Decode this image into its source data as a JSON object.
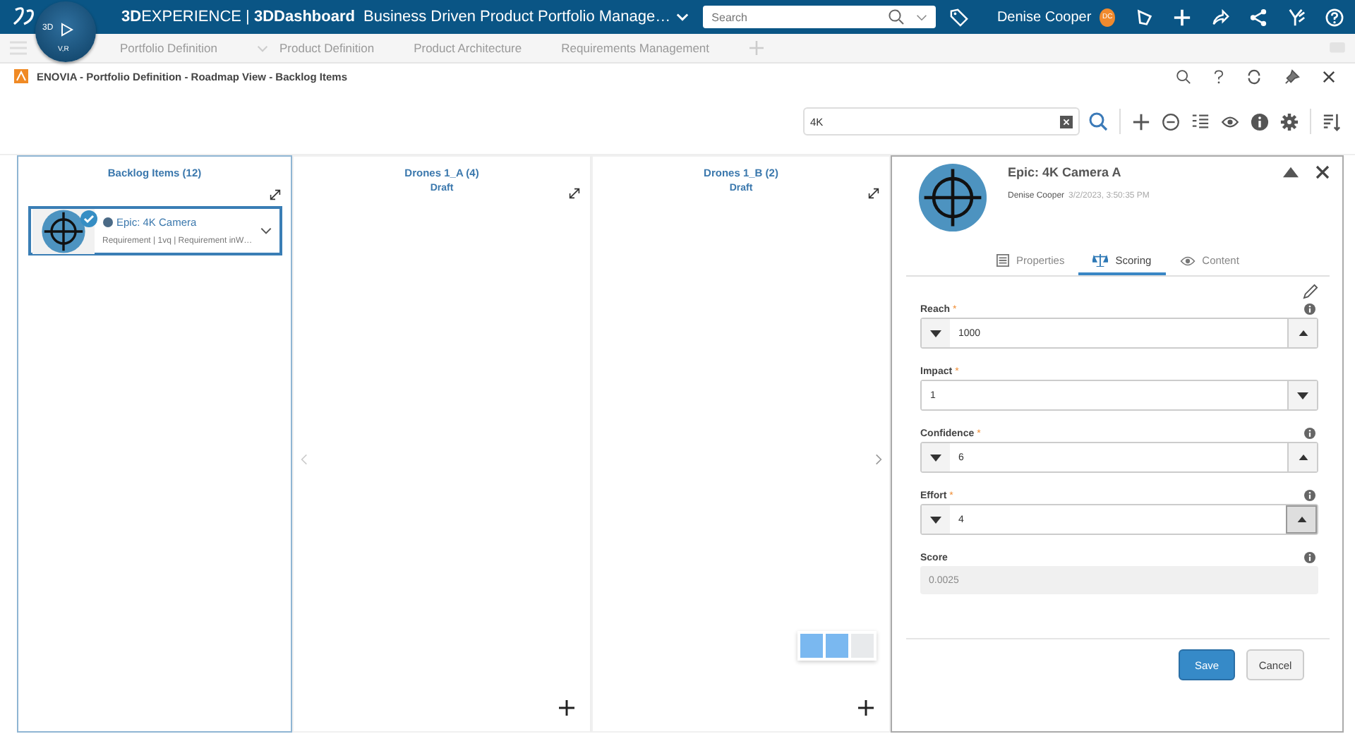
{
  "top_bar": {
    "brand": "**3D**EXPERIENCE | **3DDashboard**",
    "dashboard_title": "Business Driven Product Portfolio Manage…",
    "search": {
      "placeholder": "Search"
    },
    "user": "Denise Cooper",
    "avatar": "DC",
    "compass_labels": [
      "3D",
      "V,R"
    ]
  },
  "tabs": [
    {
      "label": "Portfolio Definition",
      "dropdown": true
    },
    {
      "label": "Product Definition"
    },
    {
      "label": "Product Architecture"
    },
    {
      "label": "Requirements Management"
    }
  ],
  "widget": {
    "title": "ENOVIA - Portfolio Definition - Roadmap View - Backlog Items"
  },
  "toolbar": {
    "search": {
      "value": "4K"
    }
  },
  "columns": [
    {
      "title": "Backlog Items (12)",
      "selected": true,
      "cards": [
        {
          "title": "Epic: 4K Camera",
          "meta": "Requirement | 1vq | Requirement inW…",
          "checked": true,
          "selected": true
        }
      ]
    },
    {
      "title": "Drones 1_A (4)",
      "status": "Draft",
      "selected": false
    },
    {
      "title": "Drones 1_B (2)",
      "status": "Draft",
      "selected": false
    }
  ],
  "layout_switch": [
    {
      "selected": true
    },
    {
      "selected": true
    },
    {
      "selected": false
    }
  ],
  "details": {
    "title": "Epic: 4K Camera A",
    "author": "Denise Cooper",
    "date": "3/2/2023, 3:50:35 PM",
    "tabs": [
      {
        "label": "Properties",
        "selected": false
      },
      {
        "label": "Scoring",
        "selected": true
      },
      {
        "label": "Content",
        "selected": false
      }
    ],
    "fields": [
      {
        "kind": "spinner",
        "label": "Reach",
        "required_mark": "*",
        "info": true,
        "value": "1000",
        "pressed": false
      },
      {
        "kind": "select",
        "label": "Impact",
        "required_mark": "*",
        "value": "1"
      },
      {
        "kind": "spinner",
        "label": "Confidence",
        "required_mark": "*",
        "info": true,
        "value": "6",
        "pressed": false
      },
      {
        "kind": "spinner",
        "label": "Effort",
        "required_mark": "*",
        "info": true,
        "value": "4",
        "pressed": true
      },
      {
        "kind": "readonly",
        "label": "Score",
        "info": true,
        "value": "0.0025"
      }
    ],
    "buttons": {
      "save": "Save",
      "cancel": "Cancel"
    }
  }
}
